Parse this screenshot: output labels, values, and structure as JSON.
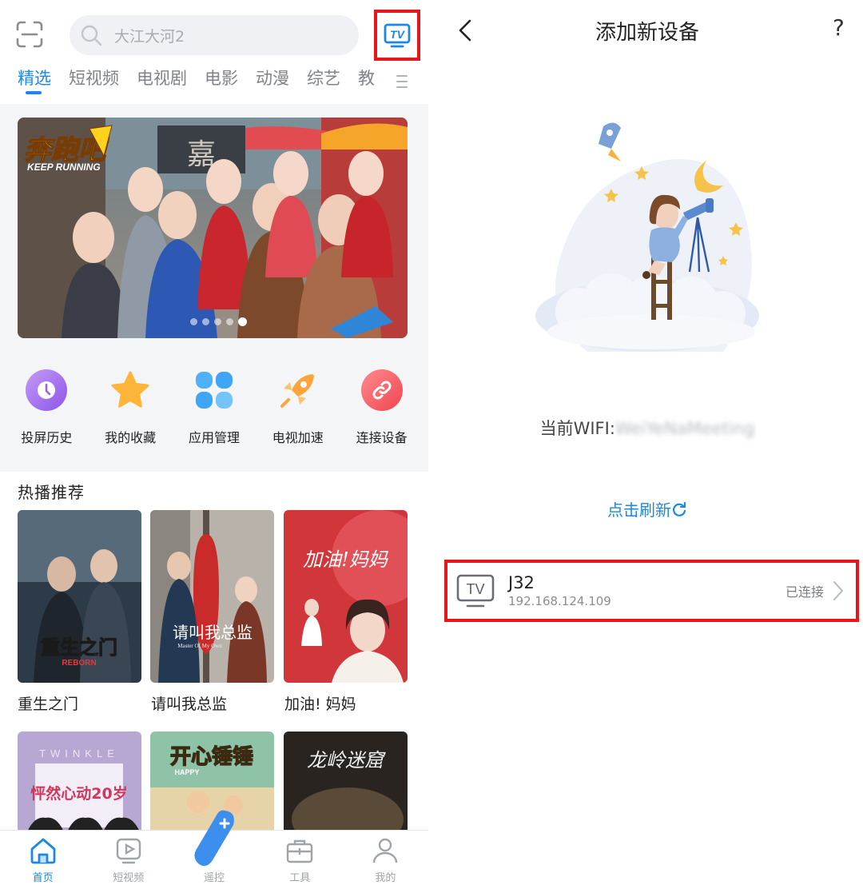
{
  "left_app": {
    "search": {
      "placeholder": "大江大河2"
    },
    "tv_button_label": "TV",
    "tabs": [
      "精选",
      "短视频",
      "电视剧",
      "电影",
      "动漫",
      "综艺",
      "教"
    ],
    "banner": {
      "title_logo": "奔跑吧",
      "subtitle": "KEEP RUNNING",
      "sign": "嘉",
      "active_dot": 5,
      "dot_count": 5
    },
    "quick_actions": [
      {
        "label": "投屏历史",
        "icon": "clock-icon",
        "color": "#a86ef0"
      },
      {
        "label": "我的收藏",
        "icon": "star-icon",
        "color": "#ffb43a"
      },
      {
        "label": "应用管理",
        "icon": "apps-grid-icon",
        "color": "#3fa6f5"
      },
      {
        "label": "电视加速",
        "icon": "rocket-icon",
        "color": "#ffa43a"
      },
      {
        "label": "连接设备",
        "icon": "link-icon",
        "color": "#f5545d"
      }
    ],
    "section_title": "热播推荐",
    "posters": [
      {
        "title": "重生之门",
        "art_text": "重生之门",
        "art_sub": "REBORN"
      },
      {
        "title": "请叫我总监",
        "art_text": "请叫我总监",
        "art_sub": "Master Of My Own"
      },
      {
        "title": "加油! 妈妈",
        "art_text": "加油!妈妈"
      }
    ],
    "posters_row2": [
      {
        "art_text": "怦然心动20岁",
        "art_sub": "TWINKLE"
      },
      {
        "art_text": "开心锤锤",
        "art_sub": "HAPPY"
      },
      {
        "art_text": "龙岭迷窟"
      }
    ],
    "bottom_nav": [
      {
        "label": "首页",
        "icon": "home-icon",
        "active": true
      },
      {
        "label": "短视频",
        "icon": "play-icon",
        "active": false
      },
      {
        "label": "遥控",
        "icon": "remote-icon",
        "active": false
      },
      {
        "label": "工具",
        "icon": "toolbox-icon",
        "active": false
      },
      {
        "label": "我的",
        "icon": "user-icon",
        "active": false
      }
    ]
  },
  "right_app": {
    "title": "添加新设备",
    "help": "?",
    "wifi_label": "当前WIFI:",
    "wifi_ssid": "WeiYeNaMeeting",
    "refresh_label": "点击刷新",
    "device": {
      "name": "J32",
      "ip": "192.168.124.109",
      "status": "已连接",
      "icon_label": "TV"
    }
  },
  "colors": {
    "accent": "#1b87e8",
    "highlight_box": "#e8161b"
  }
}
